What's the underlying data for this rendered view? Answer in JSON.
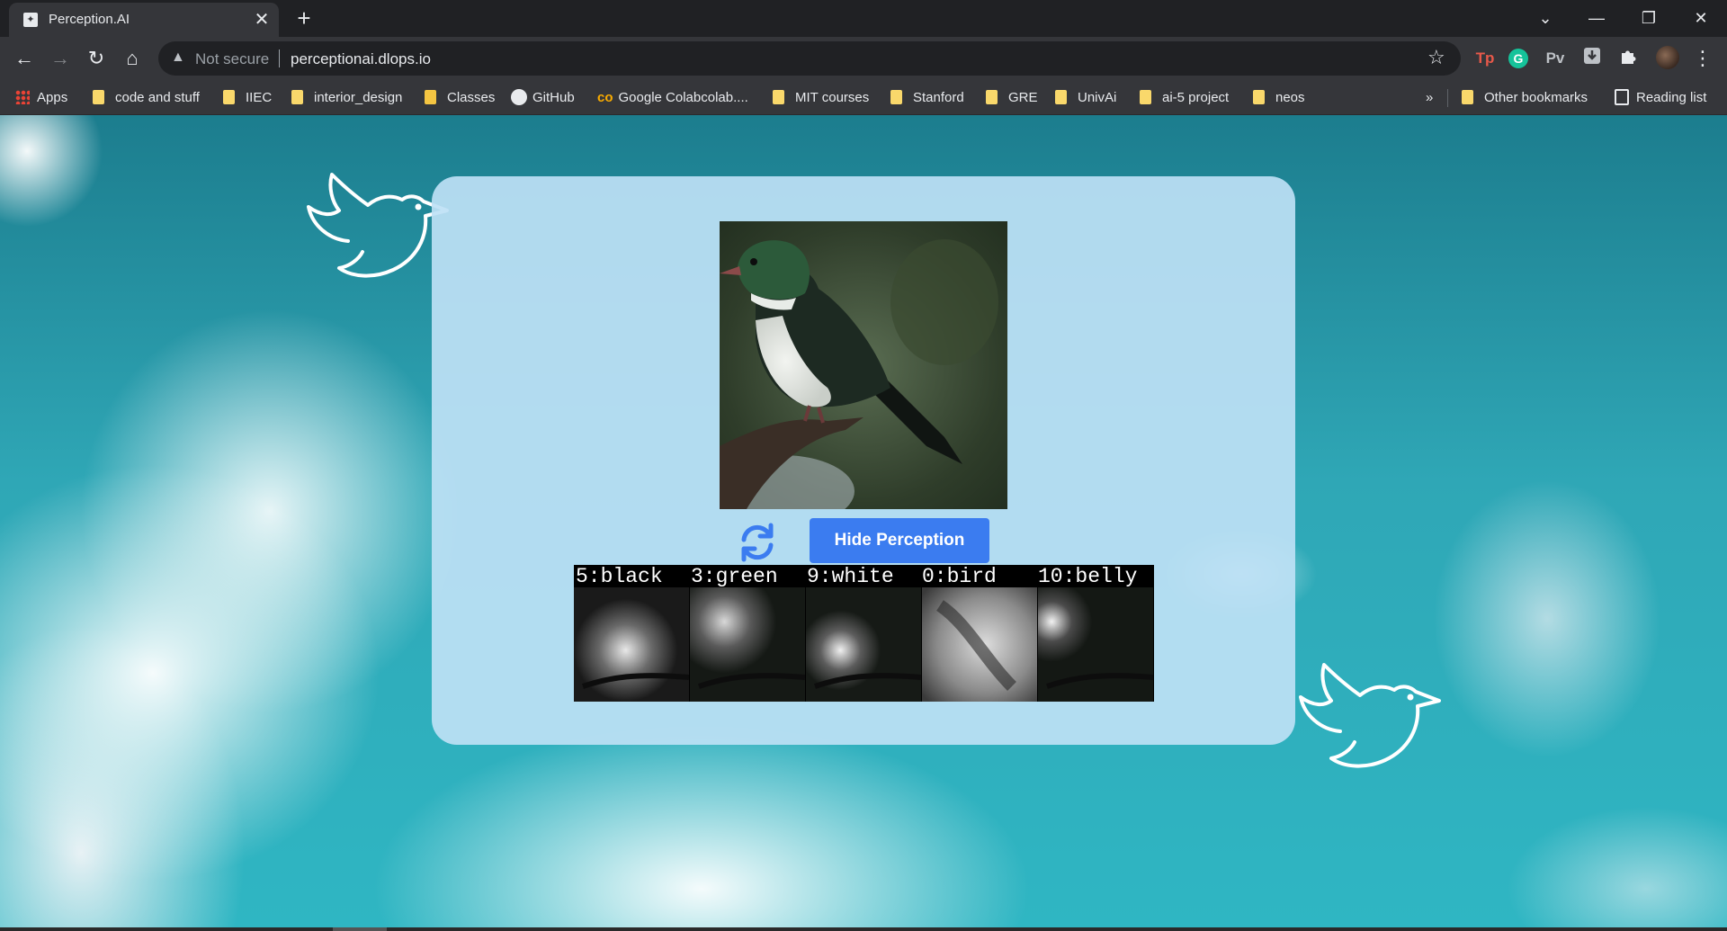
{
  "browser": {
    "tab_title": "Perception.AI",
    "tab_close": "✕",
    "new_tab": "+",
    "not_secure": "Not secure",
    "url": "perceptionai.dlops.io",
    "extensions": [
      "Tp",
      "G",
      "Pv"
    ]
  },
  "bookmarks": {
    "apps": "Apps",
    "items": [
      "code and stuff",
      "IIEC",
      "interior_design",
      "Classes",
      "GitHub",
      "Google Colabcolab....",
      "MIT courses",
      "Stanford",
      "GRE",
      "UnivAi",
      "ai-5 project",
      "neos"
    ],
    "overflow": "»",
    "other": "Other bookmarks",
    "reading_list": "Reading list"
  },
  "page": {
    "hide_button": "Hide Perception",
    "perception_labels": [
      "5:black",
      "3:green",
      "9:white",
      "0:bird",
      "10:belly"
    ]
  },
  "colors": {
    "accent_button": "#3b7cf0",
    "card": "#bee1f5",
    "sky": "#2fa7b6"
  }
}
